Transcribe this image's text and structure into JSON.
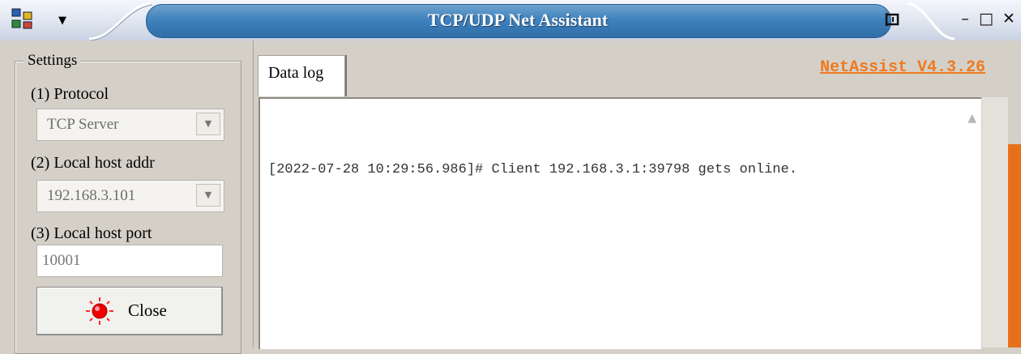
{
  "window": {
    "title": "TCP/UDP Net Assistant",
    "controls": {
      "minimize": "–",
      "maximize": "□",
      "close": "✕"
    }
  },
  "settings": {
    "legend": "Settings",
    "protocol": {
      "label": "(1) Protocol",
      "value": "TCP Server"
    },
    "local_addr": {
      "label": "(2) Local host addr",
      "value": "192.168.3.101"
    },
    "local_port": {
      "label": "(3) Local host port",
      "value": "10001"
    },
    "close_button": {
      "label": "Close",
      "status_color": "#ff0000"
    }
  },
  "log": {
    "tab_label": "Data log",
    "version_text": "NetAssist V4.3.26",
    "lines": [
      "[2022-07-28 10:29:56.986]# Client 192.168.3.1:39798 gets online."
    ]
  },
  "colors": {
    "title_accent": "#3f82bd",
    "version_link": "#f0791e",
    "side_accent": "#e8701b"
  }
}
